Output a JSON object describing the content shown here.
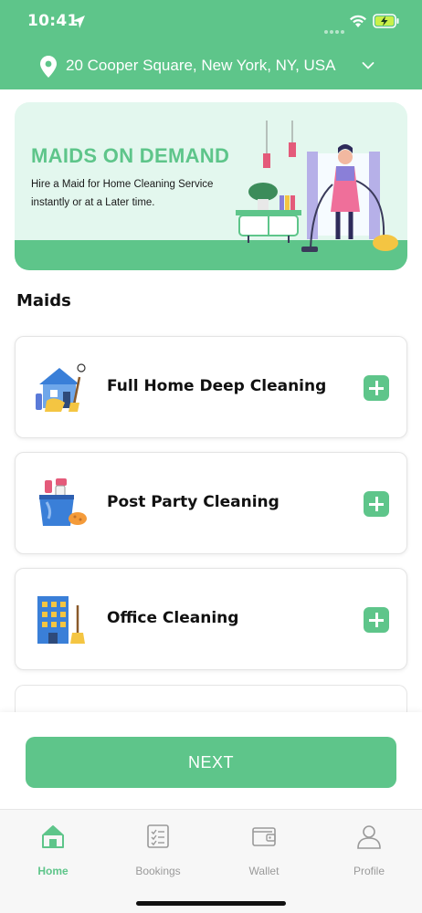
{
  "status_bar": {
    "time": "10:41"
  },
  "header": {
    "address": "20 Cooper Square, New York, NY, USA"
  },
  "banner": {
    "title": "MAIDS ON DEMAND",
    "subtitle": "Hire a Maid for Home Cleaning Service instantly or at a Later time."
  },
  "section": {
    "title": "Maids"
  },
  "services": [
    {
      "label": "Full Home Deep Cleaning",
      "icon": "house-cleaning-icon"
    },
    {
      "label": "Post Party Cleaning",
      "icon": "cleaning-bucket-icon"
    },
    {
      "label": "Office Cleaning",
      "icon": "office-building-icon"
    }
  ],
  "footer": {
    "next_label": "NEXT"
  },
  "tabbar": {
    "tabs": [
      {
        "label": "Home",
        "icon": "home-icon",
        "active": true
      },
      {
        "label": "Bookings",
        "icon": "checklist-icon",
        "active": false
      },
      {
        "label": "Wallet",
        "icon": "wallet-icon",
        "active": false
      },
      {
        "label": "Profile",
        "icon": "profile-icon",
        "active": false
      }
    ]
  },
  "colors": {
    "accent": "#5ec58a",
    "banner_bg": "#e3f7ee",
    "inactive": "#9a9a9a"
  }
}
